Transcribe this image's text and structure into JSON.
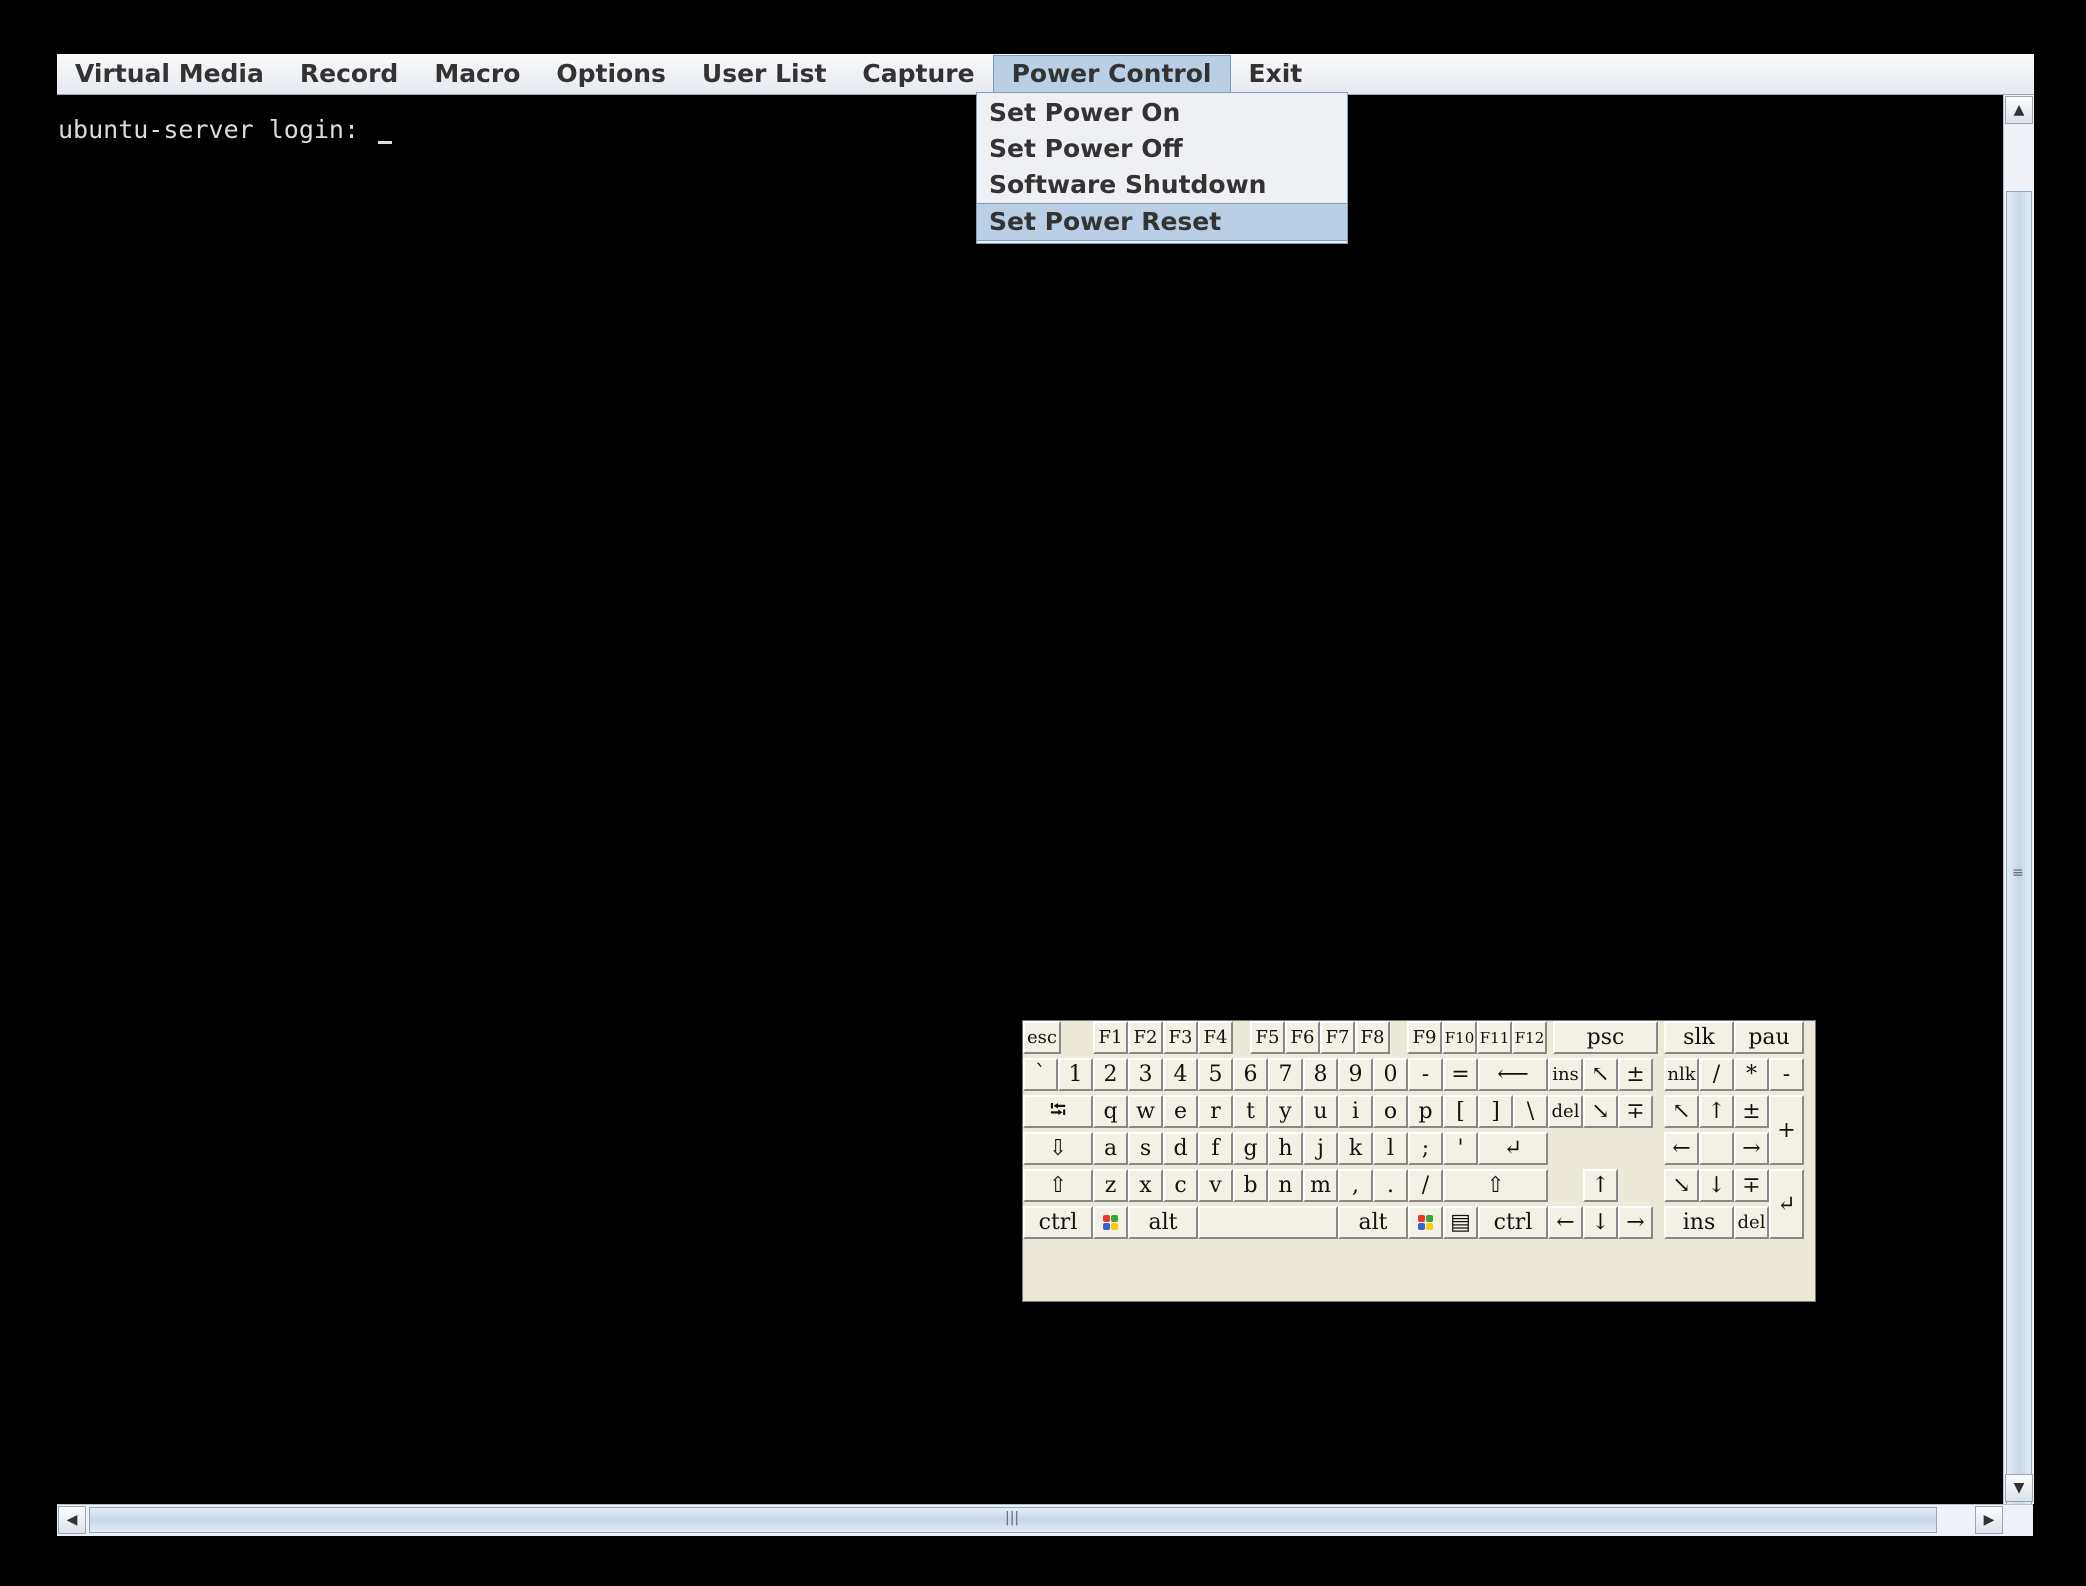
{
  "menubar": {
    "items": [
      "Virtual Media",
      "Record",
      "Macro",
      "Options",
      "User List",
      "Capture",
      "Power Control",
      "Exit"
    ],
    "active": "Power Control"
  },
  "power_menu": {
    "items": [
      "Set Power On",
      "Set Power Off",
      "Software Shutdown",
      "Set Power Reset"
    ],
    "highlighted": "Set Power Reset"
  },
  "console": {
    "prompt": "ubuntu-server login: "
  },
  "colors": {
    "menu_highlight": "#b8cfe5",
    "keyboard_bg": "#ece9d8",
    "console_bg": "#000000"
  },
  "keyboard": {
    "row1": [
      "esc",
      "F1",
      "F2",
      "F3",
      "F4",
      "F5",
      "F6",
      "F7",
      "F8",
      "F9",
      "F10",
      "F11",
      "F12",
      "psc",
      "slk",
      "pau"
    ],
    "row2": [
      "`",
      "1",
      "2",
      "3",
      "4",
      "5",
      "6",
      "7",
      "8",
      "9",
      "0",
      "-",
      "=",
      "⟵",
      "ins",
      "↖",
      "±",
      "nlk",
      "/",
      "*",
      "-"
    ],
    "row3": [
      "⭾",
      "q",
      "w",
      "e",
      "r",
      "t",
      "y",
      "u",
      "i",
      "o",
      "p",
      "[",
      "]",
      "\\",
      "del",
      "↘",
      "∓",
      "↖",
      "↑",
      "±",
      "+"
    ],
    "row4": [
      "⇩",
      "a",
      "s",
      "d",
      "f",
      "g",
      "h",
      "j",
      "k",
      "l",
      ";",
      "'",
      "↵",
      "←",
      "→"
    ],
    "row5": [
      "⇧",
      "z",
      "x",
      "c",
      "v",
      "b",
      "n",
      "m",
      ",",
      ".",
      "/",
      "⇧",
      "↑",
      "↘",
      "↓",
      "∓",
      "↵"
    ],
    "row6": [
      "ctrl",
      "alt",
      "alt",
      "▤",
      "ctrl",
      "←",
      "↓",
      "→",
      "ins",
      "del"
    ]
  }
}
